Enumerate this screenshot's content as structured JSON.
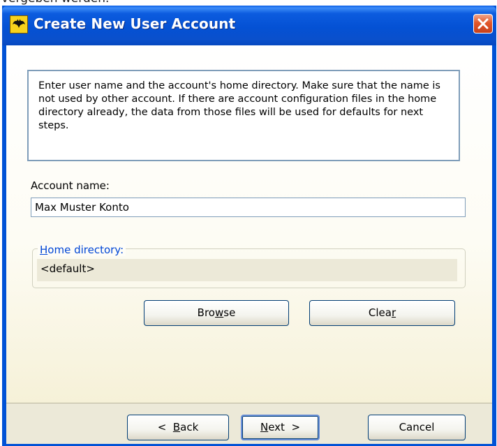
{
  "background_caption": "vergeben werden.",
  "window": {
    "title": "Create New User Account",
    "close_label": "×"
  },
  "info": {
    "text": "Enter user name and the account's home directory. Make sure that the name is not used by other account. If there are account configuration files in the home directory already, the data from those files will be used for defaults for next steps."
  },
  "account": {
    "label": "Account name:",
    "value": "Max Muster Konto"
  },
  "home_directory": {
    "legend_first": "H",
    "legend_rest": "ome directory:",
    "value": "<default>"
  },
  "buttons": {
    "browse_pre": "Bro",
    "browse_key": "w",
    "browse_post": "se",
    "clear_pre": "Clea",
    "clear_key": "r",
    "clear_post": "",
    "back_pre": "<  ",
    "back_key": "B",
    "back_post": "ack",
    "next_key": "N",
    "next_post": "ext  >",
    "cancel": "Cancel"
  },
  "colors": {
    "titlebar": "#0052d6",
    "accent_link": "#0046d5",
    "dialog_face": "#ece9d8",
    "close_button": "#e2572a"
  },
  "icons": {
    "app": "batman-logo-icon",
    "close": "close-icon"
  }
}
